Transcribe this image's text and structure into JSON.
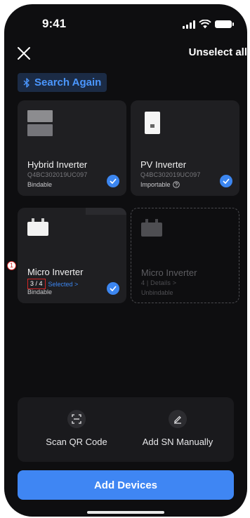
{
  "status_bar": {
    "time": "9:41"
  },
  "header": {
    "close_icon": "close-icon",
    "unselect_all": "Unselect all"
  },
  "search_again": {
    "icon": "bluetooth-icon",
    "label": "Search Again"
  },
  "devices": [
    {
      "name": "Hybrid Inverter",
      "sn": "Q4BC302019UC097",
      "status": "Bindable",
      "selected": true
    },
    {
      "name": "PV Inverter",
      "sn": "Q4BC302019UC097",
      "status": "Importable",
      "selected": true
    },
    {
      "name": "Micro Inverter",
      "count": "3 / 4",
      "link": "Selected >",
      "status": "Bindable",
      "selected": true,
      "marker": "1"
    },
    {
      "name": "Micro Inverter",
      "count": "4",
      "separator": "|",
      "link": "Details >",
      "status": "Unbindable",
      "selected": false
    }
  ],
  "tools": {
    "scan": {
      "icon": "scan-qr-icon",
      "label": "Scan QR Code"
    },
    "manual": {
      "icon": "pencil-icon",
      "label": "Add SN Manually"
    }
  },
  "primary_button": {
    "label": "Add Devices"
  },
  "colors": {
    "accent": "#3f86f3",
    "background": "#0e0e10",
    "card": "#1f1f22",
    "highlight": "#d32525"
  }
}
